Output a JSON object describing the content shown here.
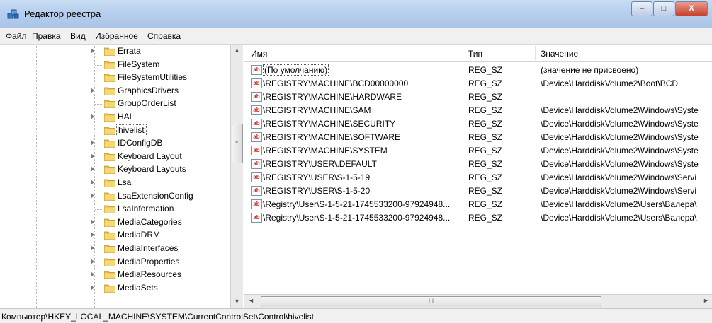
{
  "window": {
    "title": "Редактор реестра",
    "minimize_glyph": "–",
    "maximize_glyph": "□",
    "close_glyph": "X"
  },
  "menu": [
    {
      "label": "Файл"
    },
    {
      "label": "Правка"
    },
    {
      "label": "Вид"
    },
    {
      "label": "Избранное"
    },
    {
      "label": "Справка"
    }
  ],
  "tree": {
    "selected": "hivelist",
    "items": [
      {
        "label": "Errata",
        "expandable": true
      },
      {
        "label": "FileSystem",
        "expandable": false
      },
      {
        "label": "FileSystemUtilities",
        "expandable": false
      },
      {
        "label": "GraphicsDrivers",
        "expandable": true
      },
      {
        "label": "GroupOrderList",
        "expandable": false
      },
      {
        "label": "HAL",
        "expandable": true
      },
      {
        "label": "hivelist",
        "expandable": false
      },
      {
        "label": "IDConfigDB",
        "expandable": true
      },
      {
        "label": "Keyboard Layout",
        "expandable": true
      },
      {
        "label": "Keyboard Layouts",
        "expandable": true
      },
      {
        "label": "Lsa",
        "expandable": true
      },
      {
        "label": "LsaExtensionConfig",
        "expandable": true
      },
      {
        "label": "LsaInformation",
        "expandable": false
      },
      {
        "label": "MediaCategories",
        "expandable": true
      },
      {
        "label": "MediaDRM",
        "expandable": true
      },
      {
        "label": "MediaInterfaces",
        "expandable": true
      },
      {
        "label": "MediaProperties",
        "expandable": true
      },
      {
        "label": "MediaResources",
        "expandable": true
      },
      {
        "label": "MediaSets",
        "expandable": true
      }
    ]
  },
  "list": {
    "columns": {
      "name": "Имя",
      "type": "Тип",
      "value": "Значение"
    },
    "value_icon": "ab",
    "rows": [
      {
        "name": "(По умолчанию)",
        "type": "REG_SZ",
        "value": "(значение не присвоено)"
      },
      {
        "name": "\\REGISTRY\\MACHINE\\BCD00000000",
        "type": "REG_SZ",
        "value": "\\Device\\HarddiskVolume2\\Boot\\BCD"
      },
      {
        "name": "\\REGISTRY\\MACHINE\\HARDWARE",
        "type": "REG_SZ",
        "value": ""
      },
      {
        "name": "\\REGISTRY\\MACHINE\\SAM",
        "type": "REG_SZ",
        "value": "\\Device\\HarddiskVolume2\\Windows\\Syste"
      },
      {
        "name": "\\REGISTRY\\MACHINE\\SECURITY",
        "type": "REG_SZ",
        "value": "\\Device\\HarddiskVolume2\\Windows\\Syste"
      },
      {
        "name": "\\REGISTRY\\MACHINE\\SOFTWARE",
        "type": "REG_SZ",
        "value": "\\Device\\HarddiskVolume2\\Windows\\Syste"
      },
      {
        "name": "\\REGISTRY\\MACHINE\\SYSTEM",
        "type": "REG_SZ",
        "value": "\\Device\\HarddiskVolume2\\Windows\\Syste"
      },
      {
        "name": "\\REGISTRY\\USER\\.DEFAULT",
        "type": "REG_SZ",
        "value": "\\Device\\HarddiskVolume2\\Windows\\Syste"
      },
      {
        "name": "\\REGISTRY\\USER\\S-1-5-19",
        "type": "REG_SZ",
        "value": "\\Device\\HarddiskVolume2\\Windows\\Servi"
      },
      {
        "name": "\\REGISTRY\\USER\\S-1-5-20",
        "type": "REG_SZ",
        "value": "\\Device\\HarddiskVolume2\\Windows\\Servi"
      },
      {
        "name": "\\Registry\\User\\S-1-5-21-1745533200-97924948...",
        "type": "REG_SZ",
        "value": "\\Device\\HarddiskVolume2\\Users\\Валера\\"
      },
      {
        "name": "\\Registry\\User\\S-1-5-21-1745533200-97924948...",
        "type": "REG_SZ",
        "value": "\\Device\\HarddiskVolume2\\Users\\Валера\\"
      }
    ]
  },
  "scrollbars": {
    "up": "▲",
    "down": "▼",
    "left": "◄",
    "right": "►",
    "grip": "III"
  },
  "status": {
    "path": "Компьютер\\HKEY_LOCAL_MACHINE\\SYSTEM\\CurrentControlSet\\Control\\hivelist"
  },
  "colors": {
    "folder": "#e8c04c",
    "selection_border": "#666666",
    "title_bar": "#b7cfee"
  }
}
